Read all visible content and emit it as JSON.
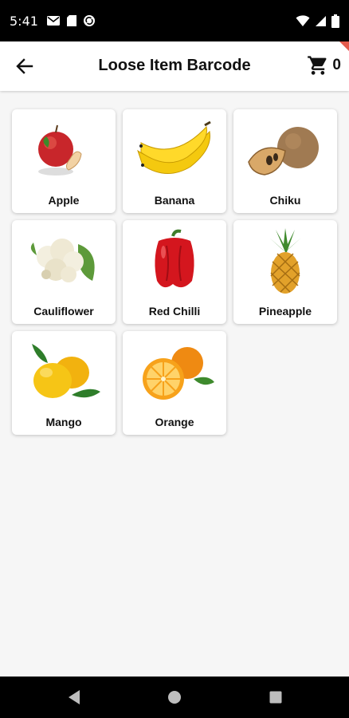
{
  "status_bar": {
    "time": "5:41",
    "icons": [
      "gmail-icon",
      "sd-card-icon",
      "sync-icon",
      "wifi-icon",
      "signal-icon",
      "battery-icon"
    ]
  },
  "app_bar": {
    "title": "Loose Item Barcode",
    "back_icon": "arrow-left-icon",
    "cart_icon": "cart-icon",
    "cart_count": "0"
  },
  "items": [
    {
      "label": "Apple",
      "icon": "apple-icon"
    },
    {
      "label": "Banana",
      "icon": "banana-icon"
    },
    {
      "label": "Chiku",
      "icon": "chiku-icon"
    },
    {
      "label": "Cauliflower",
      "icon": "cauliflower-icon"
    },
    {
      "label": "Red Chilli",
      "icon": "red-chilli-icon"
    },
    {
      "label": "Pineapple",
      "icon": "pineapple-icon"
    },
    {
      "label": "Mango",
      "icon": "mango-icon"
    },
    {
      "label": "Orange",
      "icon": "orange-icon"
    }
  ],
  "nav_bar": {
    "buttons": [
      "back-triangle-icon",
      "home-circle-icon",
      "recents-square-icon"
    ]
  },
  "colors": {
    "background": "#f6f6f6",
    "accent_corner": "#e45b4c",
    "text": "#111111"
  }
}
